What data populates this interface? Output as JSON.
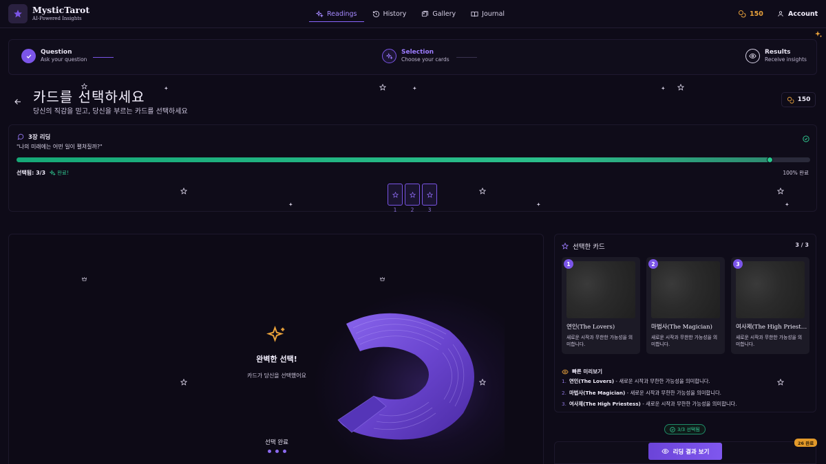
{
  "app": {
    "name": "MysticTarot",
    "tagline": "AI-Powered Insights"
  },
  "nav": [
    {
      "label": "Readings",
      "icon": "sparkles-icon",
      "active": true
    },
    {
      "label": "History",
      "icon": "history-icon",
      "active": false
    },
    {
      "label": "Gallery",
      "icon": "gallery-icon",
      "active": false
    },
    {
      "label": "Journal",
      "icon": "book-icon",
      "active": false
    }
  ],
  "header": {
    "coins": "150",
    "account_label": "Account"
  },
  "stepper": [
    {
      "title": "Question",
      "subtitle": "Ask your question",
      "state": "done"
    },
    {
      "title": "Selection",
      "subtitle": "Choose your cards",
      "state": "active"
    },
    {
      "title": "Results",
      "subtitle": "Receive insights",
      "state": "upcoming"
    }
  ],
  "page": {
    "title": "카드를 선택하세요",
    "subtitle": "당신의 직감을 믿고, 당신을 부르는 카드를 선택하세요",
    "coins": "150"
  },
  "progress": {
    "spread_label": "3장 리딩",
    "question": "\"나의 미래에는 어떤 일이 펼쳐질까?\"",
    "selected_text": "선택됨: 3/3",
    "done_text": "완료!",
    "percent_text": "100% 완료",
    "fraction": 0.95,
    "slots": [
      "1",
      "2",
      "3"
    ]
  },
  "deck": {
    "title": "완벽한 선택!",
    "subtitle": "카드가 당신을 선택했어요",
    "footer": "선택 완료"
  },
  "selected": {
    "header": "선택한 카드",
    "count": "3 / 3",
    "cards": [
      {
        "num": "1",
        "name": "연인(The Lovers)",
        "desc": "새로운 시작과 무한한 가능성을 의미합니다."
      },
      {
        "num": "2",
        "name": "마법사(The Magician)",
        "desc": "새로운 시작과 무한한 가능성을 의미합니다."
      },
      {
        "num": "3",
        "name": "여사제(The High Priestess)",
        "desc": "새로운 시작과 무한한 가능성을 의미합니다."
      }
    ],
    "preview_title": "빠른 미리보기",
    "preview": [
      {
        "n": "1.",
        "name": "연인(The Lovers)",
        "text": " - 새로운 시작과 무한한 가능성을 의미합니다."
      },
      {
        "n": "2.",
        "name": "마법사(The Magician)",
        "text": " - 새로운 시작과 무한한 가능성을 의미합니다."
      },
      {
        "n": "3.",
        "name": "여사제(The High Priestess)",
        "text": " - 새로운 시작과 무한한 가능성을 의미합니다."
      }
    ]
  },
  "footer": {
    "badge": "3/3 선택됨",
    "result_button": "리딩 결과 보기",
    "float_badge": "26 완료"
  },
  "colors": {
    "accent": "#7b55e8",
    "success": "#2fc48e",
    "gold": "#e9a23b",
    "background": "#0e0b18"
  }
}
